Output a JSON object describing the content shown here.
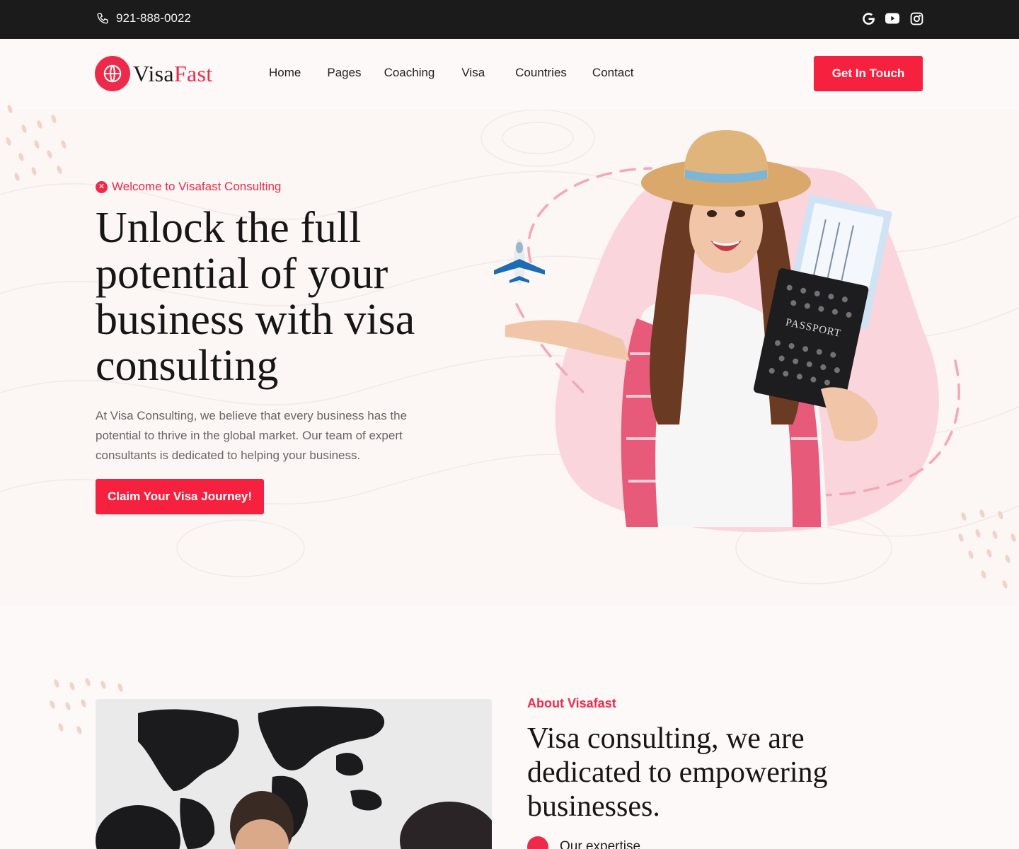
{
  "topbar": {
    "phone": "921-888-0022",
    "socials": [
      "google-icon",
      "youtube-icon",
      "instagram-icon"
    ]
  },
  "header": {
    "logo_part1": "Visa",
    "logo_part2": "Fast",
    "nav": [
      "Home",
      "Pages",
      "Coaching",
      "Visa",
      "Countries",
      "Contact"
    ],
    "cta": "Get In Touch"
  },
  "hero": {
    "kicker": "Welcome to Visafast Consulting",
    "title": "Unlock the full potential of your business with visa consulting",
    "description": "At Visa Consulting, we believe that every business has the potential to thrive in the global market. Our team of expert consultants is dedicated to helping your business.",
    "cta": "Claim Your Visa Journey!",
    "passport_text": "PASSPORT"
  },
  "about": {
    "kicker": "About Visafast",
    "title": "Visa consulting, we are dedicated to empowering businesses.",
    "feature": "Our expertise"
  },
  "colors": {
    "accent": "#ee2a4b",
    "topbar": "#1c1b1c",
    "background": "#fdf9f8"
  }
}
